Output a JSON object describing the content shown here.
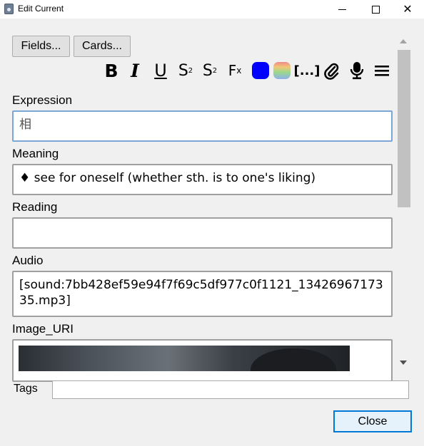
{
  "window": {
    "title": "Edit Current",
    "close_glyph": "✕"
  },
  "top_buttons": {
    "fields": "Fields...",
    "cards": "Cards..."
  },
  "toolbar": {
    "bold": "B",
    "italic": "I",
    "underline": "U",
    "superscript": "S",
    "superscript_mark": "2",
    "subscript": "S",
    "subscript_mark": "2",
    "clear_format": "F",
    "clear_format_mark": "x",
    "cloze": "[...]",
    "text_color": "#0000ff",
    "icons": [
      "bold-icon",
      "italic-icon",
      "underline-icon",
      "superscript-icon",
      "subscript-icon",
      "clear-format-icon",
      "text-color-icon",
      "highlight-color-icon",
      "cloze-icon",
      "attach-icon",
      "microphone-icon",
      "more-menu-icon"
    ]
  },
  "fields": [
    {
      "label": "Expression",
      "value": "相"
    },
    {
      "label": "Meaning",
      "value": "♦ see for oneself (whether sth. is to one's liking)"
    },
    {
      "label": "Reading",
      "value": ""
    },
    {
      "label": "Audio",
      "value": "[sound:7bb428ef59e94f7f69c5df977c0f1121_1342696717335.mp3]"
    },
    {
      "label": "Image_URI",
      "value": ""
    }
  ],
  "tags": {
    "label": "Tags",
    "value": ""
  },
  "close_button": "Close",
  "colors": {
    "accent": "#0078d7",
    "focus_border": "#7aa7d6"
  }
}
